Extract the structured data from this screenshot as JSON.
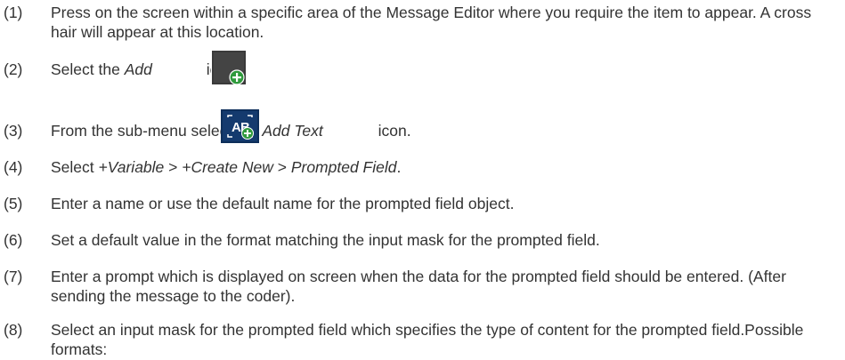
{
  "steps": [
    {
      "num": "(1)",
      "text": "Press on the screen within a specific area of the Message Editor where you require the item to appear. A cross hair will appear at this location."
    },
    {
      "num": "(2)",
      "pre": "Select the ",
      "italic": "Add",
      "icon": "add-icon",
      "post": " icon."
    },
    {
      "num": "(3)",
      "pre": "From the sub-menu select the ",
      "italic": "Add Text",
      "icon": "add-text-icon",
      "post": " icon."
    },
    {
      "num": "(4)",
      "pre": "Select ",
      "parts": [
        "+Variable",
        " > ",
        "+Create New",
        " > ",
        "Prompted Field",
        "."
      ]
    },
    {
      "num": "(5)",
      "text": "Enter a name or use the default name for the prompted field object."
    },
    {
      "num": "(6)",
      "text": "Set a default value in the format matching the input mask for the prompted field."
    },
    {
      "num": "(7)",
      "text": "Enter a prompt which is displayed on screen when the data for the prompted field should be entered. (After sending the message to the coder)."
    },
    {
      "num": "(8)",
      "text": "Select an input mask for the prompted field which specifies the type of content for the prompted field.Possible formats:"
    }
  ],
  "colors": {
    "text": "#333333",
    "icon_dark": "#3a3a3a",
    "icon_navy": "#0d2e5a",
    "plus_green": "#2f9a3c"
  }
}
